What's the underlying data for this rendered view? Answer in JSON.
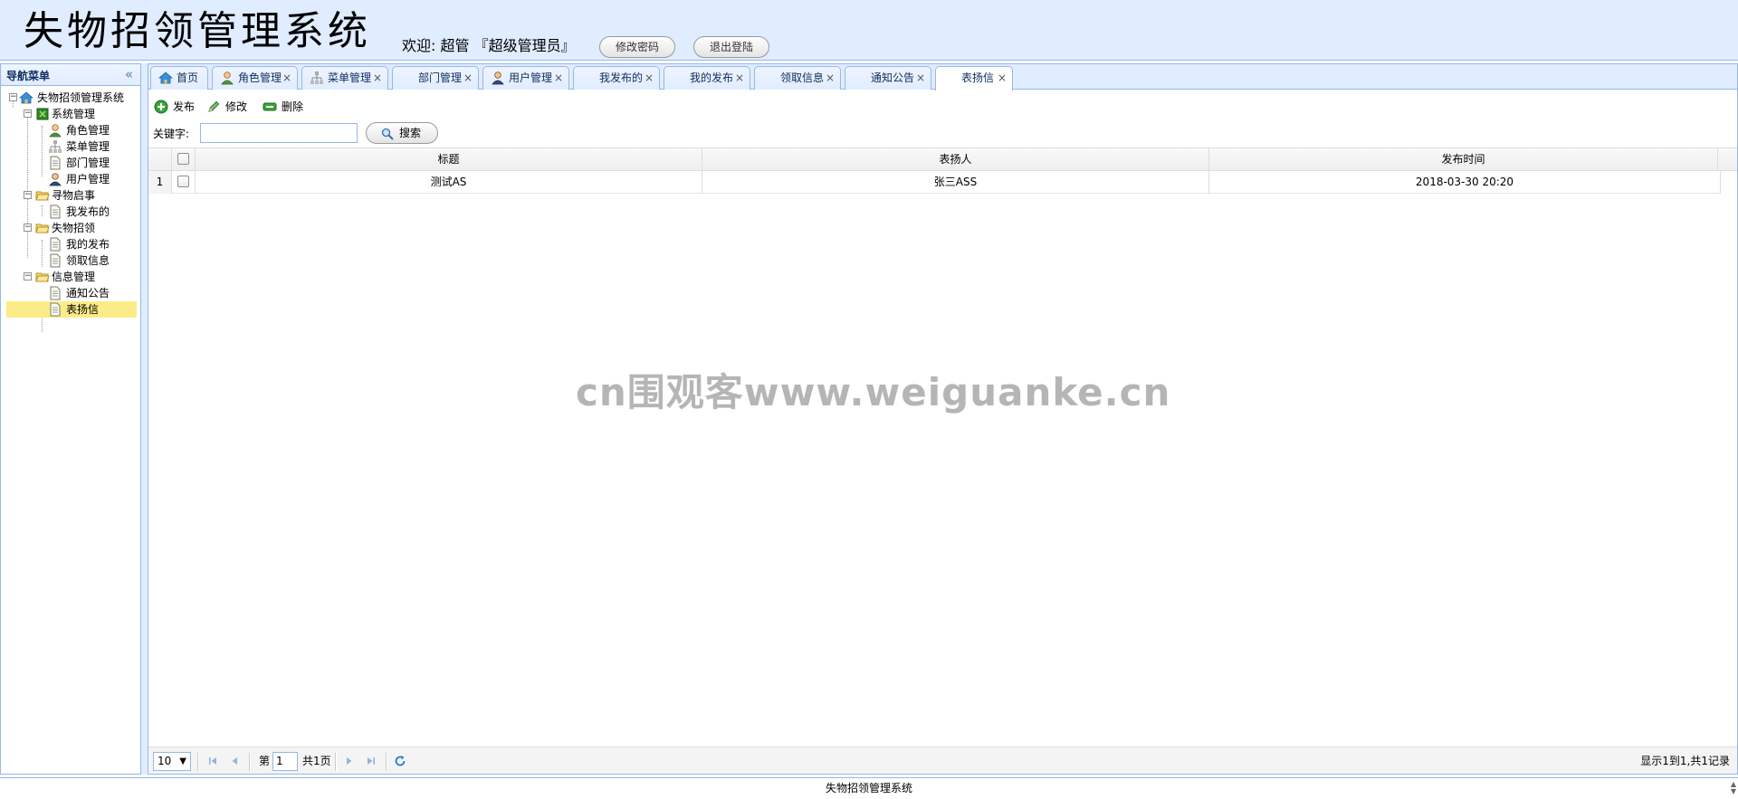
{
  "header": {
    "app_title": "失物招领管理系统",
    "welcome": "欢迎: 超管 『超级管理员』",
    "change_password": "修改密码",
    "logout": "退出登陆"
  },
  "left_panel": {
    "title": "导航菜单",
    "collapse_icon": "double-chevron-left-icon",
    "tree": {
      "root": "失物招领管理系统",
      "groups": [
        {
          "label": "系统管理",
          "items": [
            "角色管理",
            "菜单管理",
            "部门管理",
            "用户管理"
          ]
        },
        {
          "label": "寻物启事",
          "items": [
            "我发布的"
          ]
        },
        {
          "label": "失物招领",
          "items": [
            "我的发布",
            "领取信息"
          ]
        },
        {
          "label": "信息管理",
          "items": [
            "通知公告",
            "表扬信"
          ]
        }
      ],
      "selected": "表扬信"
    }
  },
  "tabs": [
    {
      "label": "首页",
      "icon": "home-icon",
      "closable": false
    },
    {
      "label": "角色管理",
      "icon": "user-icon",
      "closable": true
    },
    {
      "label": "菜单管理",
      "icon": "sitemap-icon",
      "closable": true
    },
    {
      "label": "部门管理",
      "icon": "",
      "closable": true
    },
    {
      "label": "用户管理",
      "icon": "user-dark-icon",
      "closable": true
    },
    {
      "label": "我发布的",
      "icon": "",
      "closable": true
    },
    {
      "label": "我的发布",
      "icon": "",
      "closable": true
    },
    {
      "label": "领取信息",
      "icon": "",
      "closable": true
    },
    {
      "label": "通知公告",
      "icon": "",
      "closable": true
    },
    {
      "label": "表扬信",
      "icon": "",
      "closable": true,
      "active": true
    }
  ],
  "toolbar": {
    "publish": "发布",
    "edit": "修改",
    "delete": "删除"
  },
  "search": {
    "keyword_label": "关键字:",
    "keyword_value": "",
    "button": "搜索"
  },
  "grid": {
    "columns": [
      "标题",
      "表扬人",
      "发布时间"
    ],
    "rows": [
      {
        "num": "1",
        "title": "测试AS",
        "praiser": "张三ASS",
        "time": "2018-03-30 20:20"
      }
    ]
  },
  "pager": {
    "page_size": "10",
    "page_prefix": "第",
    "page_value": "1",
    "page_suffix": "共1页",
    "info": "显示1到1,共1记录"
  },
  "watermark": "cn围观客www.weiguanke.cn",
  "footer": "失物招领管理系统"
}
